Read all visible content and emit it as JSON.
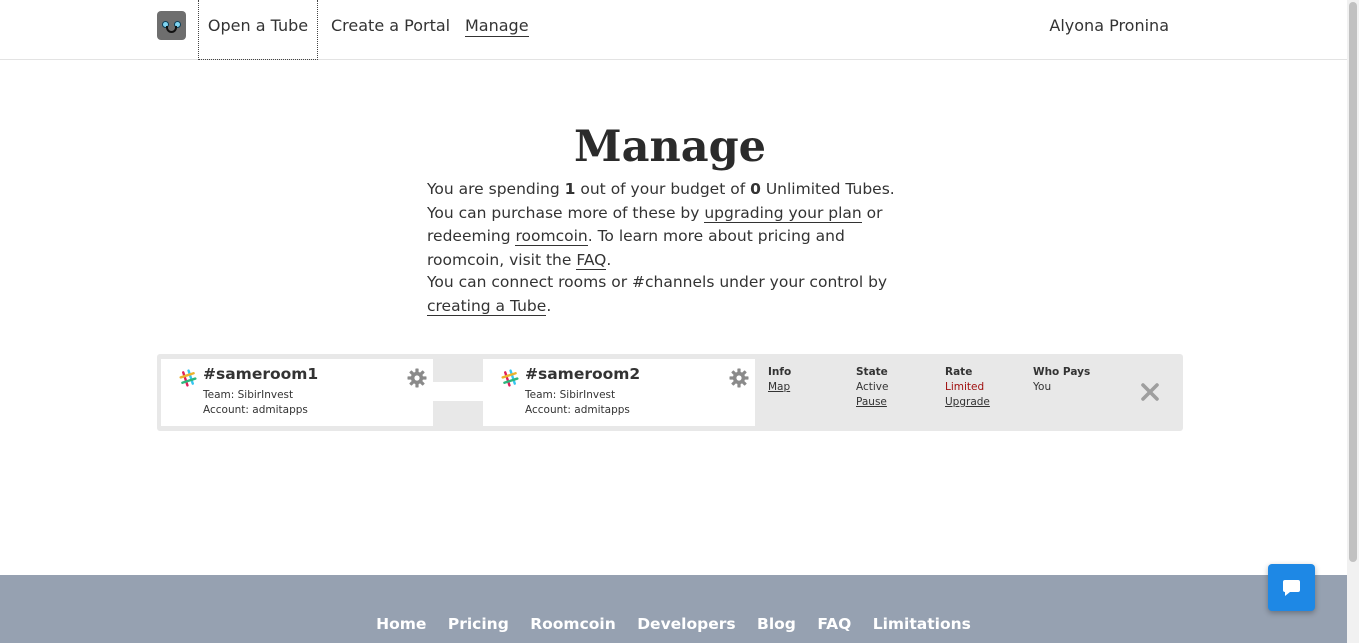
{
  "header": {
    "nav": [
      "Open a Tube",
      "Create a Portal",
      "Manage"
    ],
    "user": "Alyona Pronina"
  },
  "main": {
    "title": "Manage",
    "para1": {
      "t1": "You are spending ",
      "used": "1",
      "t2": " out of your budget of ",
      "budget": "0",
      "t3": " Unlimited Tubes. You can purchase more of these by ",
      "link_upgrade": "upgrading your plan",
      "t4": " or redeeming ",
      "link_roomcoin": "roomcoin",
      "t5": ". To learn more about pricing and roomcoin, visit the ",
      "link_faq": "FAQ",
      "t6": "."
    },
    "para2": {
      "t1": "You can connect rooms or #channels under your control by ",
      "link_create": "creating a Tube",
      "t2": "."
    }
  },
  "tube": {
    "rooms": [
      {
        "name": "#sameroom1",
        "team": "Team: SibirInvest",
        "account": "Account: admitapps"
      },
      {
        "name": "#sameroom2",
        "team": "Team: SibirInvest",
        "account": "Account: admitapps"
      }
    ],
    "info": {
      "header": "Info",
      "link": "Map"
    },
    "state": {
      "header": "State",
      "value": "Active",
      "link": "Pause"
    },
    "rate": {
      "header": "Rate",
      "value": "Limited",
      "link": "Upgrade",
      "value_color": "#a01010"
    },
    "who": {
      "header": "Who Pays",
      "value": "You"
    }
  },
  "footer": {
    "links": [
      "Home",
      "Pricing",
      "Roomcoin",
      "Developers",
      "Blog",
      "FAQ",
      "Limitations"
    ]
  },
  "icons": [
    "logo-icon",
    "slack-icon",
    "gear-icon",
    "close-icon",
    "chat-icon"
  ],
  "colors": {
    "footer_bg": "#96a1b1",
    "chat_button": "#1e88e5",
    "tube_bg": "#e8e8e8"
  }
}
